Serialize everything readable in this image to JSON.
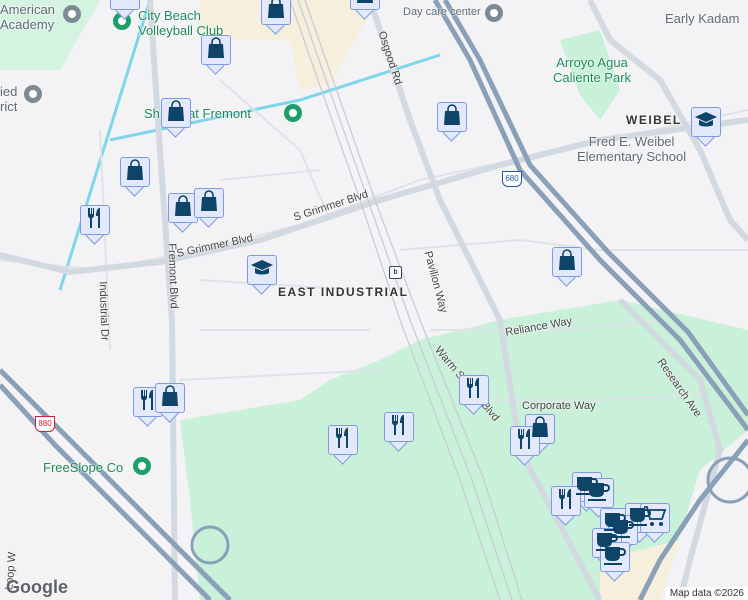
{
  "places": {
    "american_academy": "American\nAcademy",
    "city_beach": "City Beach\nVolleyball Club",
    "shoreline": "Sh   ce at Fremont",
    "day_care": "Day care center",
    "early_kadam": "Early Kadam",
    "arroyo_park": "Arroyo Agua\nCaliente Park",
    "fred_weibel": "Fred E. Weibel\nElementary School",
    "freeslope": "FreeSlope Co",
    "partial_district": "ied\nrict"
  },
  "districts": {
    "east_industrial": "EAST INDUSTRIAL",
    "weibel": "WEIBEL"
  },
  "roads": {
    "osgood": "Osgood Rd",
    "grimmer1": "S Grimmer Blvd",
    "grimmer2": "S Grimmer Blvd",
    "fremont": "Fremont Blvd",
    "industrial": "Industrial Dr",
    "pavilion": "Pavilion Way",
    "reliance": "Reliance Way",
    "warm_springs": "Warm Springs Blvd",
    "corporate": "Corporate Way",
    "research": "Research Ave",
    "loop": "Loop W"
  },
  "highways": {
    "i680": "680",
    "i880": "880"
  },
  "footer": {
    "logo": "Google",
    "attribution": "Map data ©2026"
  },
  "colors": {
    "marker_fill": "#e3e9fb",
    "marker_border": "#7c9be0",
    "icon": "#0d4468",
    "park": "#c9f0d9",
    "highway": "#8a9fb8"
  }
}
